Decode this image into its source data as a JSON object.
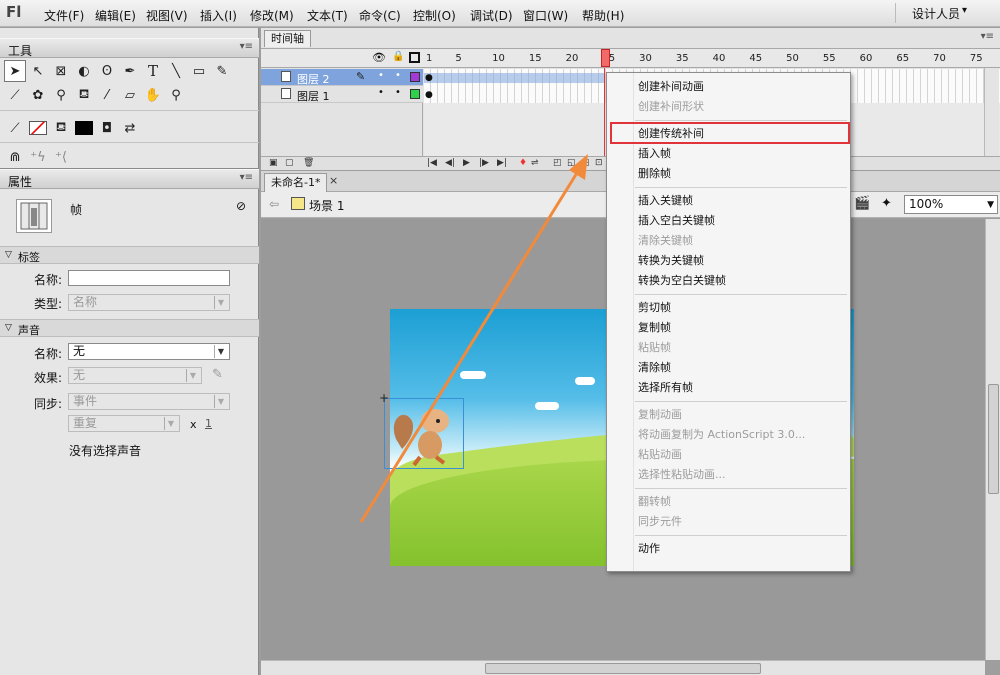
{
  "app": {
    "logo": "Fl",
    "menu": [
      "文件(F)",
      "编辑(E)",
      "视图(V)",
      "插入(I)",
      "修改(M)",
      "文本(T)",
      "命令(C)",
      "控制(O)",
      "调试(D)",
      "窗口(W)",
      "帮助(H)"
    ],
    "workspace": "设计人员",
    "workspace_arrow": "▾"
  },
  "tools": {
    "title": "工具",
    "panel_menu": "▾≡"
  },
  "properties": {
    "title": "属性",
    "panel_menu": "▾≡",
    "frame_label": "帧",
    "label_section": "标签",
    "name_label": "名称:",
    "type_label": "类型:",
    "type_value": "名称",
    "sound_section": "声音",
    "sound_name_label": "名称:",
    "sound_name_value": "无",
    "effect_label": "效果:",
    "effect_value": "无",
    "sync_label": "同步:",
    "sync_value": "事件",
    "repeat_value": "重复",
    "repeat_x": "x",
    "repeat_count": "1",
    "no_sound": "没有选择声音"
  },
  "timeline": {
    "tab": "时间轴",
    "panel_menu": "▾≡",
    "frame_numbers": [
      "1",
      "5",
      "10",
      "15",
      "20",
      "25",
      "30",
      "35",
      "40",
      "45",
      "50",
      "55",
      "60",
      "65",
      "70",
      "75"
    ],
    "layers": [
      {
        "name": "图层 2",
        "selected": true
      },
      {
        "name": "图层 1",
        "selected": false
      }
    ],
    "controls": [
      "|◀",
      "◀|",
      "▶",
      "|▶",
      "▶|"
    ]
  },
  "document": {
    "tab": "未命名-1*",
    "tab_close": "×",
    "scene_back": "⇦",
    "scene": "场景 1",
    "zoom": "100%"
  },
  "context_menu": {
    "items": [
      {
        "label": "创建补间动画",
        "disabled": false
      },
      {
        "label": "创建补间形状",
        "disabled": true
      },
      {
        "label": "创建传统补间",
        "disabled": false,
        "highlighted": true
      },
      {
        "label": "插入帧",
        "disabled": false
      },
      {
        "label": "删除帧",
        "disabled": false
      },
      {
        "label": "插入关键帧",
        "disabled": false
      },
      {
        "label": "插入空白关键帧",
        "disabled": false
      },
      {
        "label": "清除关键帧",
        "disabled": true
      },
      {
        "label": "转换为关键帧",
        "disabled": false
      },
      {
        "label": "转换为空白关键帧",
        "disabled": false
      },
      {
        "label": "剪切帧",
        "disabled": false
      },
      {
        "label": "复制帧",
        "disabled": false
      },
      {
        "label": "粘贴帧",
        "disabled": true
      },
      {
        "label": "清除帧",
        "disabled": false
      },
      {
        "label": "选择所有帧",
        "disabled": false
      },
      {
        "label": "复制动画",
        "disabled": true
      },
      {
        "label": "将动画复制为 ActionScript 3.0...",
        "disabled": true
      },
      {
        "label": "粘贴动画",
        "disabled": true
      },
      {
        "label": "选择性粘贴动画...",
        "disabled": true
      },
      {
        "label": "翻转帧",
        "disabled": true
      },
      {
        "label": "同步元件",
        "disabled": true
      },
      {
        "label": "动作",
        "disabled": false
      }
    ]
  },
  "colors": {
    "highlight_box": "#e0333a",
    "arrow": "#f28a3c",
    "selected_layer": "#7fa4dd"
  }
}
